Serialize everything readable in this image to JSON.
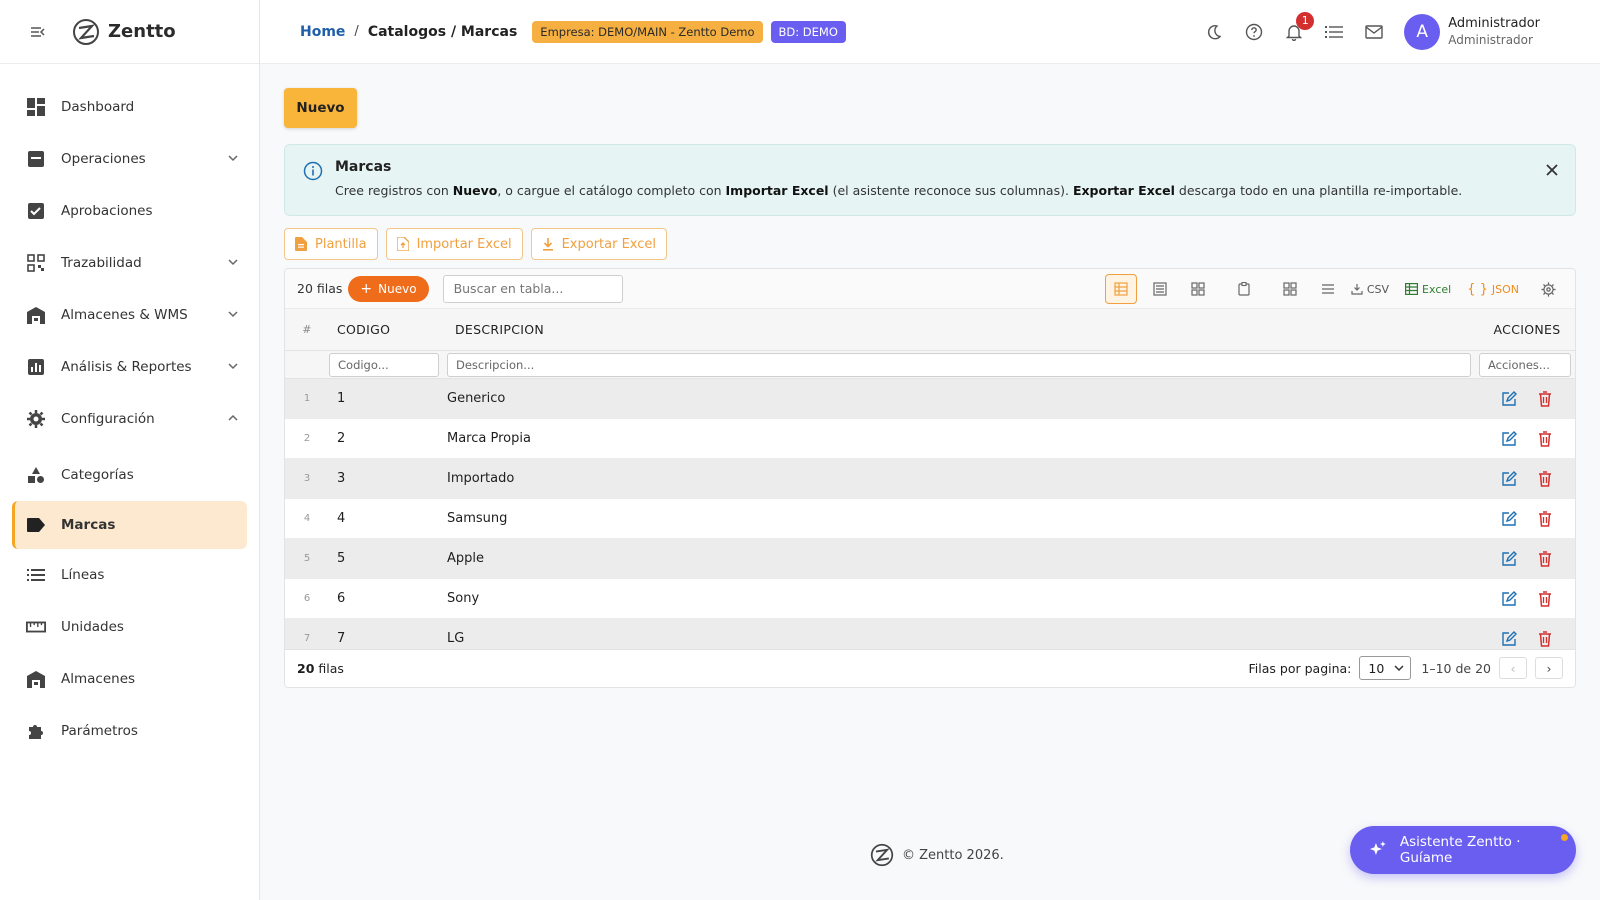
{
  "brand": {
    "name": "Zentto"
  },
  "sidebar": {
    "items": [
      {
        "label": "Dashboard",
        "icon": "dashboard-icon"
      },
      {
        "label": "Operaciones",
        "icon": "inbox-icon",
        "expandable": true
      },
      {
        "label": "Aprobaciones",
        "icon": "approval-icon"
      },
      {
        "label": "Trazabilidad",
        "icon": "qr-icon",
        "expandable": true
      },
      {
        "label": "Almacenes & WMS",
        "icon": "warehouse-icon",
        "expandable": true
      },
      {
        "label": "Análisis & Reportes",
        "icon": "chart-icon",
        "expandable": true
      },
      {
        "label": "Configuración",
        "icon": "gear-icon",
        "expandable": true,
        "expanded": true
      },
      {
        "label": "Categorías",
        "icon": "category-icon"
      },
      {
        "label": "Marcas",
        "icon": "tag-icon",
        "active": true
      },
      {
        "label": "Líneas",
        "icon": "list-icon"
      },
      {
        "label": "Unidades",
        "icon": "ruler-icon"
      },
      {
        "label": "Almacenes",
        "icon": "warehouse-icon"
      },
      {
        "label": "Parámetros",
        "icon": "puzzle-icon"
      }
    ]
  },
  "header": {
    "breadcrumb": {
      "home": "Home",
      "sep": "/",
      "current": "Catalogos / Marcas"
    },
    "empresa_chip": "Empresa: DEMO/MAIN - Zentto Demo",
    "bd_chip": "BD: DEMO",
    "notifications_count": "1",
    "user": {
      "initial": "A",
      "name": "Administrador",
      "role": "Administrador"
    }
  },
  "main": {
    "new_button": "Nuevo",
    "alert": {
      "title": "Marcas",
      "parts": {
        "p1": "Cree registros con ",
        "b1": "Nuevo",
        "p2": ", o cargue el catálogo completo con ",
        "b2": "Importar Excel",
        "p3": " (el asistente reconoce sus columnas). ",
        "b3": "Exportar Excel",
        "p4": " descarga todo en una plantilla re-importable."
      }
    },
    "actions": {
      "template": "Plantilla",
      "import": "Importar Excel",
      "export": "Exportar Excel"
    }
  },
  "grid": {
    "row_count_label": "20 filas",
    "new_pill": "Nuevo",
    "search_placeholder": "Buscar en tabla...",
    "toolbar": {
      "csv": "CSV",
      "excel": "Excel",
      "json": "JSON"
    },
    "columns": {
      "num": "#",
      "code": "CODIGO",
      "desc": "DESCRIPCION",
      "actions": "ACCIONES"
    },
    "filters": {
      "code": "Codigo...",
      "desc": "Descripcion...",
      "actions": "Acciones..."
    },
    "rows": [
      {
        "n": "1",
        "code": "1",
        "desc": "Generico"
      },
      {
        "n": "2",
        "code": "2",
        "desc": "Marca Propia"
      },
      {
        "n": "3",
        "code": "3",
        "desc": "Importado"
      },
      {
        "n": "4",
        "code": "4",
        "desc": "Samsung"
      },
      {
        "n": "5",
        "code": "5",
        "desc": "Apple"
      },
      {
        "n": "6",
        "code": "6",
        "desc": "Sony"
      },
      {
        "n": "7",
        "code": "7",
        "desc": "LG"
      }
    ],
    "footer": {
      "total": "20",
      "total_label": "filas",
      "per_page_label": "Filas por pagina:",
      "per_page_value": "10",
      "range": "1–10 de 20",
      "prev": "‹",
      "next": "›"
    }
  },
  "footer": {
    "copyright": "© Zentto 2026."
  },
  "assistant": {
    "label": "Asistente Zentto · Guíame"
  },
  "colors": {
    "accent": "#f9b43a",
    "primary": "#6a5ef0",
    "link": "#1f5fa8",
    "danger": "#d32f2f"
  }
}
